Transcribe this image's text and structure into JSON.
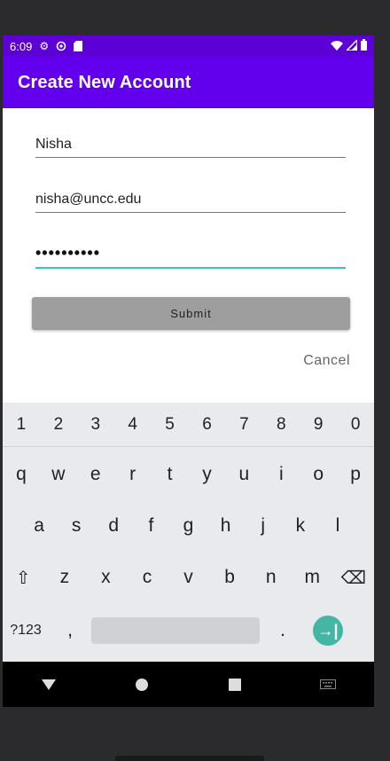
{
  "status_bar": {
    "time": "6:09",
    "icons": [
      "gear-icon",
      "at-icon",
      "sd-card-icon"
    ],
    "right_icons": [
      "wifi-icon",
      "signal-icon",
      "battery-icon"
    ]
  },
  "app_bar": {
    "title": "Create New Account"
  },
  "form": {
    "name_value": "Nisha",
    "email_value": "nisha@uncc.edu",
    "password_value": "••••••••••",
    "submit_label": "Submit",
    "cancel_label": "Cancel"
  },
  "colors": {
    "status_bar": "#5c00d6",
    "app_bar": "#6200ee",
    "focus_underline": "#34c7c0",
    "submit_bg": "#9e9e9e",
    "enter_key": "#44b6a6"
  },
  "keyboard": {
    "numbers": [
      "1",
      "2",
      "3",
      "4",
      "5",
      "6",
      "7",
      "8",
      "9",
      "0"
    ],
    "row1": [
      "q",
      "w",
      "e",
      "r",
      "t",
      "y",
      "u",
      "i",
      "o",
      "p"
    ],
    "row2": [
      "a",
      "s",
      "d",
      "f",
      "g",
      "h",
      "j",
      "k",
      "l"
    ],
    "row3": [
      "z",
      "x",
      "c",
      "v",
      "b",
      "n",
      "m"
    ],
    "sym_label": "?123",
    "comma": ",",
    "period": ".",
    "shift_glyph": "⇧",
    "backspace_glyph": "⌫",
    "enter_glyph": "→|"
  }
}
